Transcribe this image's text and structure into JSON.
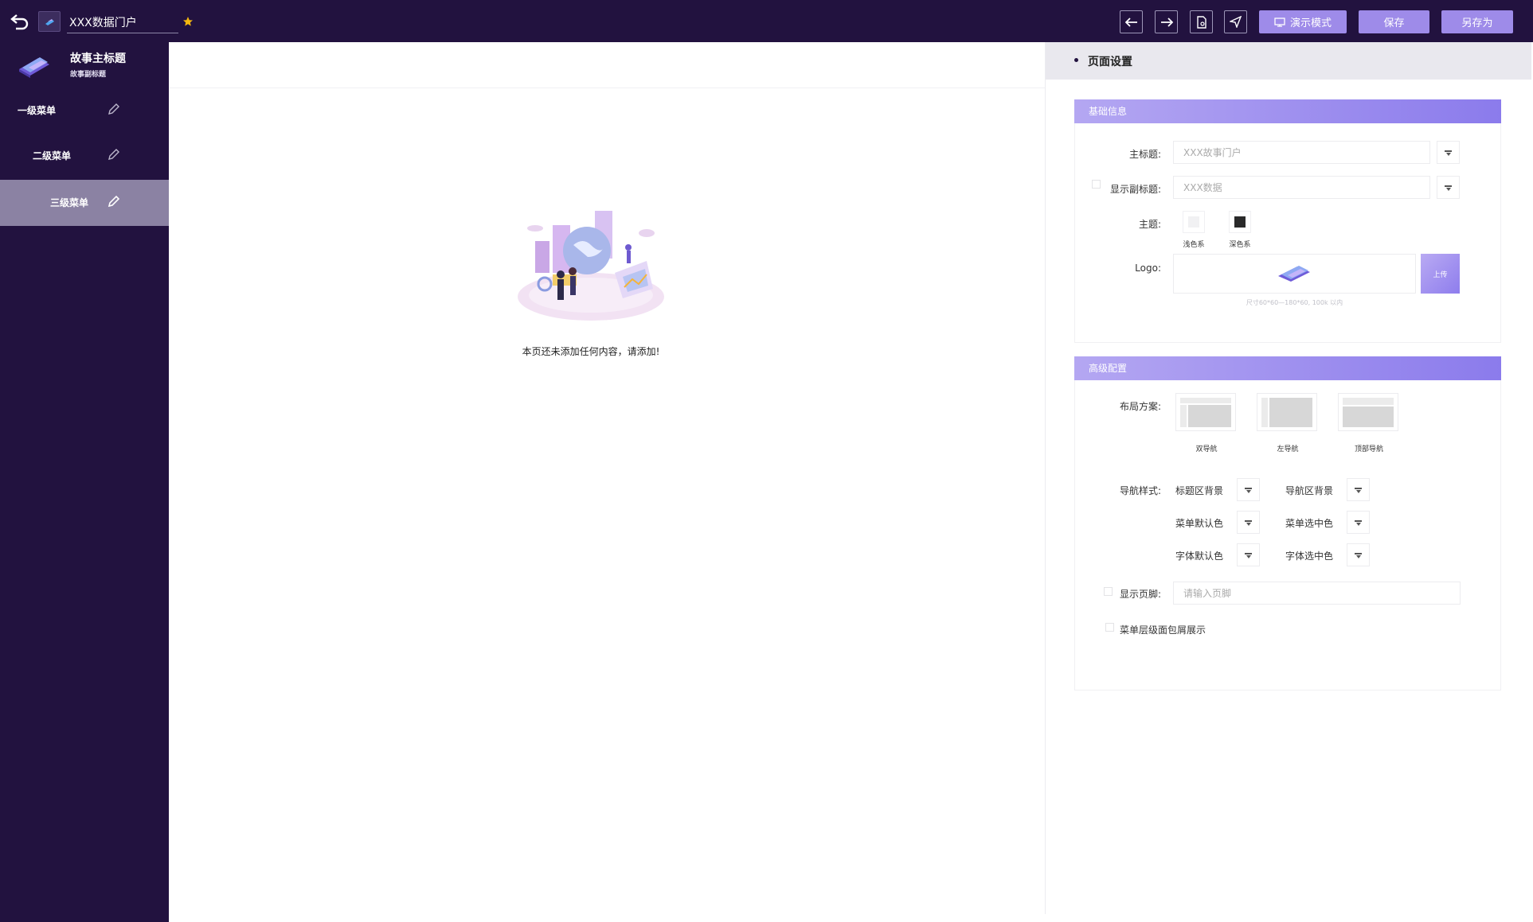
{
  "topbar": {
    "title_value": "XXX数据门户",
    "demo_label": "演示模式",
    "save_label": "保存",
    "save_as_label": "另存为",
    "accent": "#9e8be9"
  },
  "sidebar": {
    "title": "故事主标题",
    "subtitle": "故事副标题",
    "items": [
      {
        "label": "一级菜单"
      },
      {
        "label": "二级菜单"
      },
      {
        "label": "三级菜单"
      }
    ]
  },
  "main": {
    "empty_text": "本页还未添加任何内容，请添加!"
  },
  "panel": {
    "title": "页面设置",
    "basic": {
      "header": "基础信息",
      "main_title_label": "主标题:",
      "main_title_value": "XXX故事门户",
      "show_subtitle_label": "显示副标题:",
      "subtitle_value": "XXX数据",
      "theme_label": "主题:",
      "theme_light": "浅色系",
      "theme_dark": "深色系",
      "logo_label": "Logo:",
      "upload_label": "上传",
      "logo_hint": "尺寸60*60—180*60, 100k 以内"
    },
    "advanced": {
      "header": "高级配置",
      "layout_label": "布局方案:",
      "layouts": [
        "双导航",
        "左导航",
        "顶部导航"
      ],
      "nav_style_label": "导航样式:",
      "nav_options": [
        "标题区背景",
        "导航区背景",
        "菜单默认色",
        "菜单选中色",
        "字体默认色",
        "字体选中色"
      ],
      "show_footer_label": "显示页脚:",
      "footer_placeholder": "请输入页脚",
      "breadcrumb_label": "菜单层级面包屑展示"
    }
  }
}
